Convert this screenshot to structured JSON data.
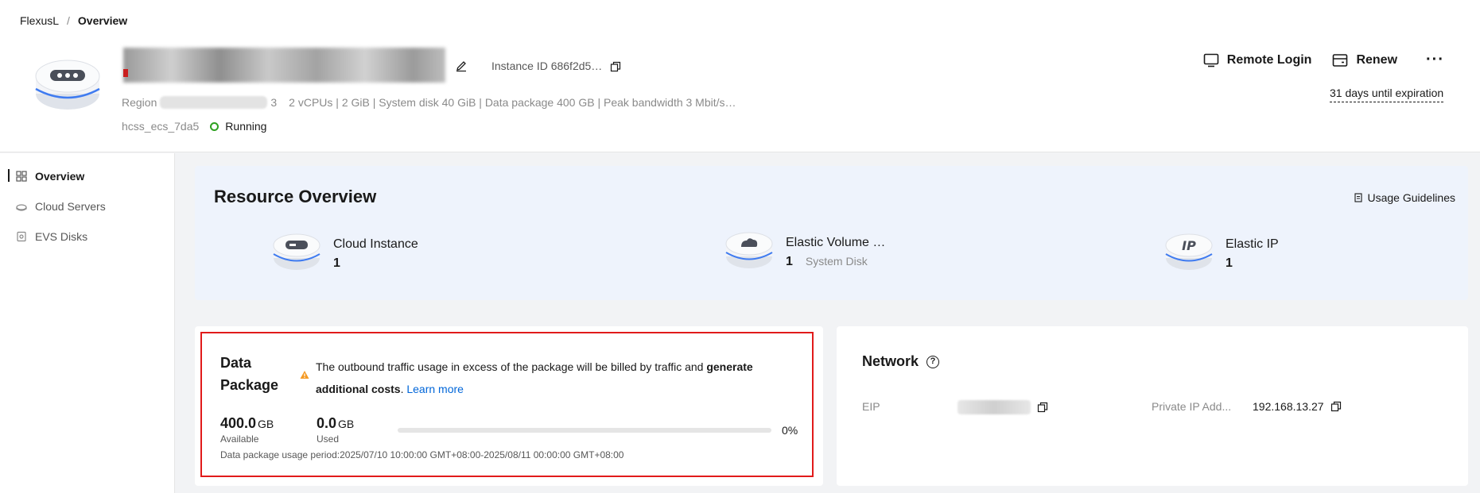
{
  "breadcrumb": {
    "root": "FlexusL",
    "separator": "/",
    "current": "Overview"
  },
  "instance": {
    "id_label": "Instance ID 686f2d5…",
    "region_label": "Region",
    "region_tail": "3",
    "specs": "2 vCPUs | 2 GiB | System disk 40 GiB | Data package 400 GB | Peak bandwidth 3 Mbit/s…",
    "hostname": "hcss_ecs_7da5",
    "status": "Running"
  },
  "actions": {
    "remote_login": "Remote Login",
    "renew": "Renew",
    "more": "···",
    "expiry": "31 days until expiration"
  },
  "sidebar": {
    "items": [
      {
        "label": "Overview",
        "icon": "grid-icon",
        "active": true
      },
      {
        "label": "Cloud Servers",
        "icon": "cloud-server-icon",
        "active": false
      },
      {
        "label": "EVS Disks",
        "icon": "disk-icon",
        "active": false
      }
    ]
  },
  "resource_overview": {
    "title": "Resource Overview",
    "guide": "Usage Guidelines",
    "items": [
      {
        "name": "Cloud Instance",
        "count": "1",
        "sub": ""
      },
      {
        "name": "Elastic Volume …",
        "count": "1",
        "sub": "System Disk"
      },
      {
        "name": "Elastic IP",
        "count": "1",
        "sub": ""
      }
    ]
  },
  "data_package": {
    "title": "Data Package",
    "notice_part1": "The outbound traffic usage in excess of the package will be billed by traffic and ",
    "notice_bold": "generate additional costs",
    "notice_part2": ". ",
    "learn_more": "Learn more",
    "available_value": "400.0",
    "available_unit": "GB",
    "available_label": "Available",
    "used_value": "0.0",
    "used_unit": "GB",
    "used_label": "Used",
    "usage_percent": 0,
    "usage_percent_label": "0%",
    "period": "Data package usage period:2025/07/10 10:00:00 GMT+08:00-2025/08/11 00:00:00 GMT+08:00"
  },
  "network": {
    "title": "Network",
    "help": "?",
    "eip_label": "EIP",
    "private_ip_label": "Private IP Add...",
    "private_ip": "192.168.13.27"
  },
  "colors": {
    "accent": "#0066d9",
    "status_ok": "#2ea121",
    "highlight": "#e11b1b",
    "overview_bg": "#eef3fc"
  }
}
